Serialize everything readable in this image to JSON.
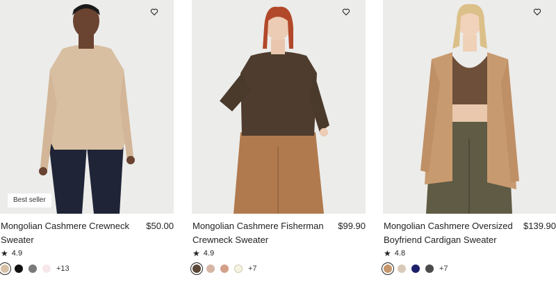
{
  "products": [
    {
      "title": "Mongolian Cashmere Crewneck Sweater",
      "price": "$50.00",
      "rating": "4.9",
      "badge": "Best seller",
      "more_colors": "+13",
      "swatch_colors": [
        "#d6c1a6",
        "#111111",
        "#7a7a7a",
        "#f6e7ea"
      ],
      "icon": "heart-outline-icon"
    },
    {
      "title": "Mongolian Cashmere Fisherman Crewneck Sweater",
      "price": "$99.90",
      "rating": "4.9",
      "more_colors": "+7",
      "swatch_colors": [
        "#5a4636",
        "#d6b5a5",
        "#d4a08a",
        "#f7f3e2"
      ],
      "icon": "heart-outline-icon"
    },
    {
      "title": "Mongolian Cashmere Oversized Boyfriend Cardigan Sweater",
      "price": "$139.90",
      "rating": "4.8",
      "more_colors": "+7",
      "swatch_colors": [
        "#c6966c",
        "#d9c9b8",
        "#1e1f6b",
        "#4b4b4b"
      ],
      "icon": "heart-outline-icon"
    }
  ]
}
